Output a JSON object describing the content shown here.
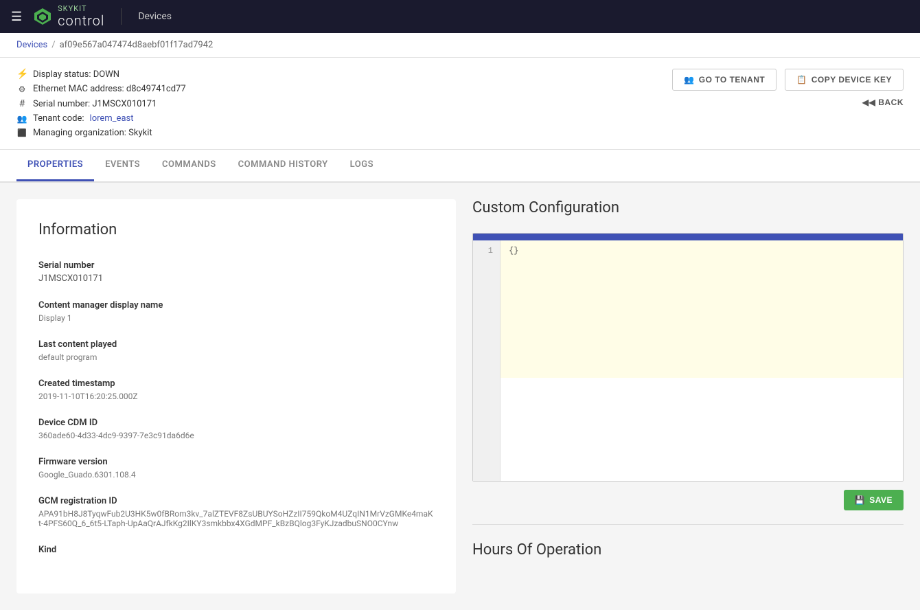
{
  "header": {
    "menu_label": "☰",
    "brand": "control",
    "page_title": "Devices"
  },
  "breadcrumb": {
    "parent_label": "Devices",
    "separator": "/",
    "current": "af09e567a047474d8aebf01f17ad7942"
  },
  "device_info": {
    "display_status_icon": "⚡",
    "display_status_label": "Display status: DOWN",
    "ethernet_icon": "⚙",
    "ethernet_label": "Ethernet MAC address: d8c49741cd77",
    "serial_icon": "#",
    "serial_label": "Serial number: J1MSCX010171",
    "tenant_icon": "👥",
    "tenant_label": "Tenant code:",
    "tenant_link": "lorem_east",
    "org_icon": "🏢",
    "org_label": "Managing organization: Skykit"
  },
  "buttons": {
    "go_to_tenant_icon": "👥",
    "go_to_tenant_label": "GO TO TENANT",
    "copy_device_key_icon": "📋",
    "copy_device_key_label": "COPY DEVICE KEY",
    "back_icon": "◀",
    "back_label": "BACK",
    "save_icon": "💾",
    "save_label": "SAVE"
  },
  "tabs": [
    {
      "id": "properties",
      "label": "PROPERTIES",
      "active": true
    },
    {
      "id": "events",
      "label": "EVENTS",
      "active": false
    },
    {
      "id": "commands",
      "label": "COMMANDS",
      "active": false
    },
    {
      "id": "command_history",
      "label": "COMMAND HISTORY",
      "active": false
    },
    {
      "id": "logs",
      "label": "LOGS",
      "active": false
    }
  ],
  "information": {
    "title": "Information",
    "fields": [
      {
        "label": "Serial number",
        "value": "J1MSCX010171"
      },
      {
        "label": "Content manager display name",
        "value": "Display 1"
      },
      {
        "label": "Last content played",
        "value": "default program"
      },
      {
        "label": "Created timestamp",
        "value": "2019-11-10T16:20:25.000Z"
      },
      {
        "label": "Device CDM ID",
        "value": "360ade60-4d33-4dc9-9397-7e3c91da6d6e"
      },
      {
        "label": "Firmware version",
        "value": "Google_Guado.6301.108.4"
      },
      {
        "label": "GCM registration ID",
        "value": "APA91bH8J8TyqwFub2U3HK5w0fBRom3kv_7alZTEVF8ZsUBUYSoHZzII759QkoM4UZqIN1MrVzGMKe4maKt-4PFS60Q_6_6t5-LTaph-UpAaQrAJfkKg2IlKY3smkbbx4XGdMPF_kBzBQlog3FyKJzadbuSNO0CYnw"
      },
      {
        "label": "Kind",
        "value": ""
      }
    ]
  },
  "custom_configuration": {
    "title": "Custom Configuration",
    "line_number": "1",
    "code_content": "{}",
    "save_label": "SAVE"
  },
  "hours_of_operation": {
    "title": "Hours Of Operation"
  }
}
